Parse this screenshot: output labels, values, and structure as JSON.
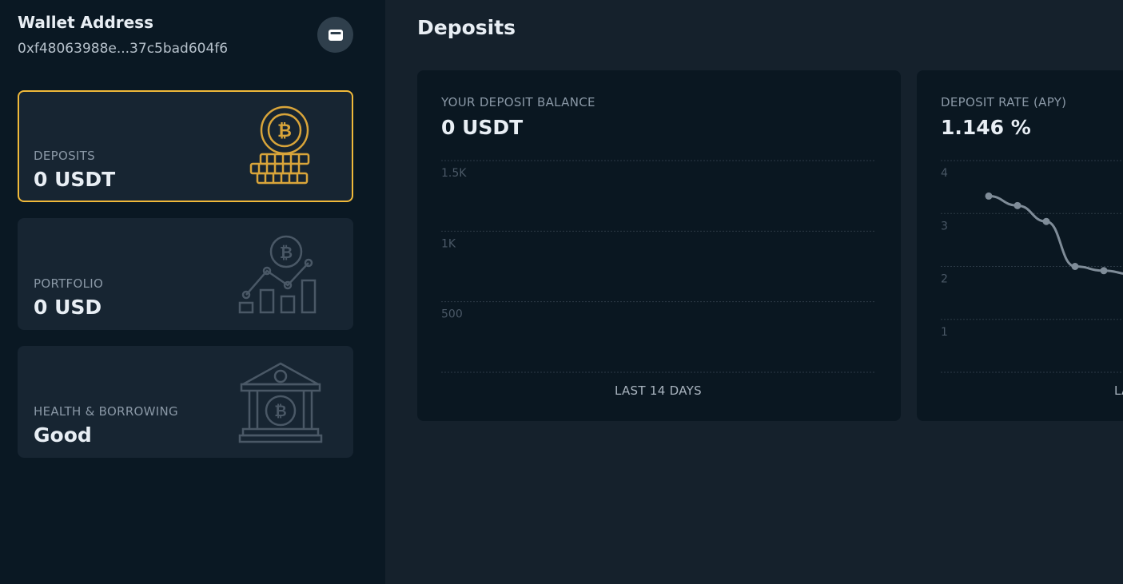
{
  "sidebar": {
    "wallet_title": "Wallet Address",
    "wallet_address": "0xf48063988e...37c5bad604f6",
    "wallet_icon": "wallet-icon",
    "cards": [
      {
        "label": "DEPOSITS",
        "value": "0 USDT",
        "icon": "bitcoin-coins-icon",
        "active": true
      },
      {
        "label": "PORTFOLIO",
        "value": "0 USD",
        "icon": "bitcoin-growth-chart-icon",
        "active": false
      },
      {
        "label": "HEALTH & BORROWING",
        "value": "Good",
        "icon": "bitcoin-bank-icon",
        "active": false
      }
    ]
  },
  "colors": {
    "accent": "#f0b93a",
    "sidebar_bg": "#0a1823",
    "main_bg": "#15212c",
    "card_bg": "#172532",
    "panel_bg": "#0a1721",
    "line": "#7f8c98"
  },
  "main": {
    "title": "Deposits",
    "panels": [
      {
        "label": "YOUR DEPOSIT BALANCE",
        "value": "0 USDT",
        "footer": "LAST 14 DAYS",
        "chart_data": {
          "type": "bar",
          "y_ticks": [
            "1.5K",
            "1K",
            "500"
          ],
          "ylim": [
            0,
            1500
          ],
          "values": [],
          "grid": true
        }
      },
      {
        "label": "DEPOSIT RATE (APY)",
        "value": "1.146 %",
        "footer": "LA",
        "chart_data": {
          "type": "line",
          "y_ticks": [
            "4",
            "3",
            "2",
            "1"
          ],
          "ylim": [
            0,
            4
          ],
          "values": [
            3.33,
            3.15,
            2.85,
            2.0,
            1.92,
            1.85
          ],
          "grid": true
        }
      }
    ]
  }
}
